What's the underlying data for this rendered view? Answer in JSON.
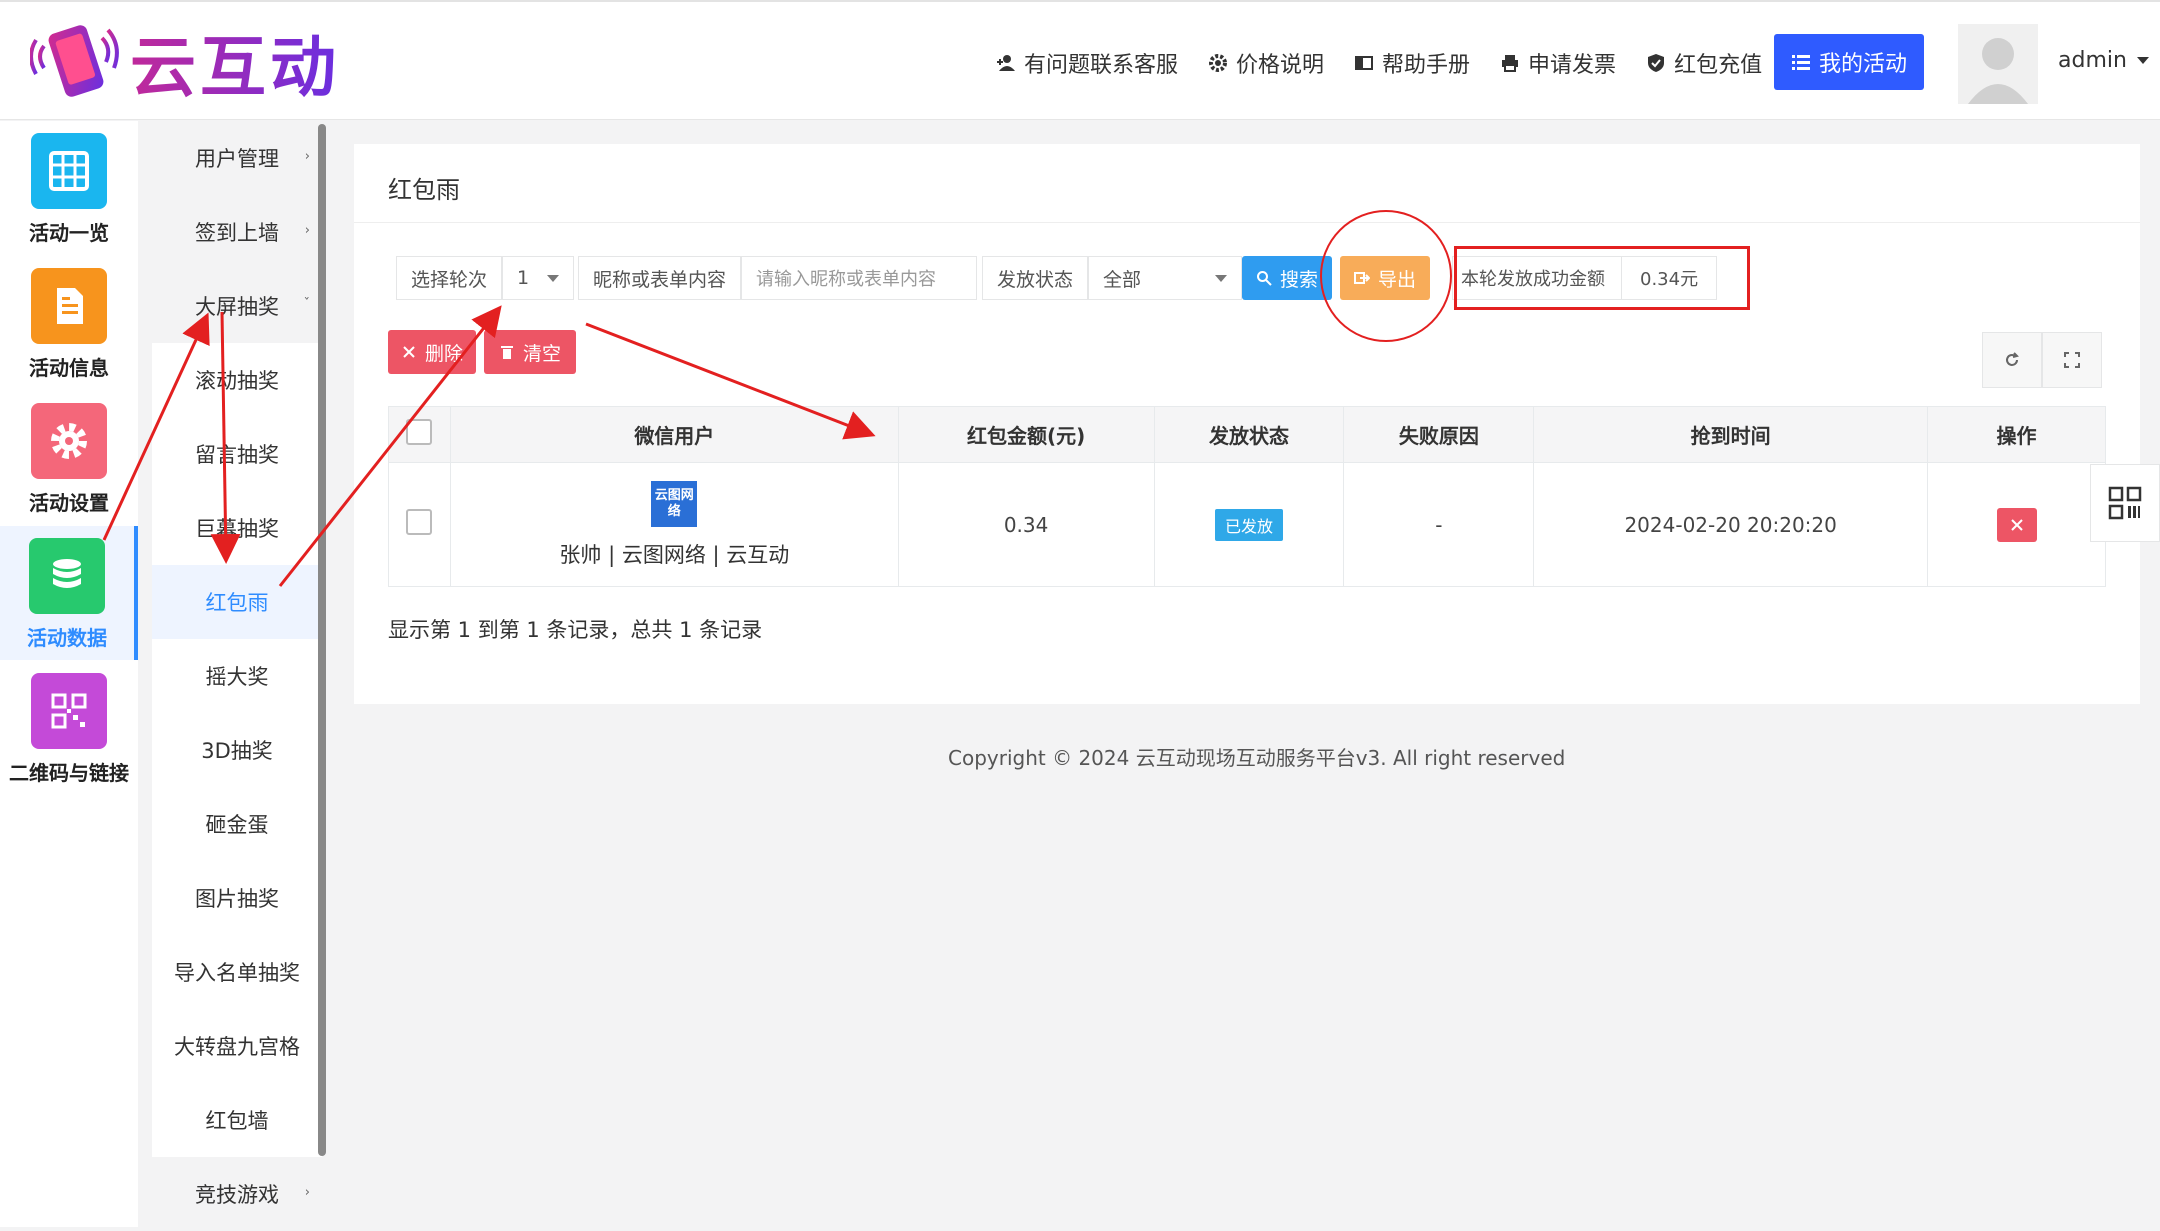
{
  "brand": {
    "name": "云互动"
  },
  "topnav": [
    {
      "label": "有问题联系客服",
      "icon": "user-plus-icon"
    },
    {
      "label": "价格说明",
      "icon": "gear-icon"
    },
    {
      "label": "帮助手册",
      "icon": "book-icon"
    },
    {
      "label": "申请发票",
      "icon": "printer-icon"
    },
    {
      "label": "红包充值",
      "icon": "shield-check-icon"
    }
  ],
  "my_activity_label": "我的活动",
  "user": {
    "name": "admin"
  },
  "rail": [
    {
      "label": "活动一览",
      "icon": "grid-icon",
      "color": "#1ab6ef"
    },
    {
      "label": "活动信息",
      "icon": "document-icon",
      "color": "#f7941d"
    },
    {
      "label": "活动设置",
      "icon": "gear-icon",
      "color": "#f4677a"
    },
    {
      "label": "活动数据",
      "icon": "database-icon",
      "color": "#27c96e"
    },
    {
      "label": "二维码与链接",
      "icon": "qrcode-icon",
      "color": "#c44ad8"
    }
  ],
  "submenu": [
    "用户管理",
    "签到上墙",
    "大屏抽奖",
    "滚动抽奖",
    "留言抽奖",
    "巨幕抽奖",
    "红包雨",
    "摇大奖",
    "3D抽奖",
    "砸金蛋",
    "图片抽奖",
    "导入名单抽奖",
    "大转盘九宫格",
    "红包墙",
    "竞技游戏"
  ],
  "panel": {
    "title": "红包雨",
    "filters": {
      "round_label": "选择轮次",
      "round_value": "1",
      "nickname_label": "昵称或表单内容",
      "nickname_placeholder": "请输入昵称或表单内容",
      "status_label": "发放状态",
      "status_value": "全部"
    },
    "search_label": "搜索",
    "export_label": "导出",
    "summary_label": "本轮发放成功金额",
    "summary_value": "0.34元",
    "delete_label": "删除",
    "clear_label": "清空",
    "table": {
      "headers": [
        "微信用户",
        "红包金额(元)",
        "发放状态",
        "失败原因",
        "抢到时间",
        "操作"
      ],
      "rows": [
        {
          "logo_text": "云图网络",
          "user": "张帅 | 云图网络 | 云互动",
          "amount": "0.34",
          "status": "已发放",
          "reason": "-",
          "time": "2024-02-20 20:20:20"
        }
      ]
    },
    "records": "显示第 1 到第 1 条记录，总共 1 条记录"
  },
  "footer": "Copyright © 2024 云互动现场互动服务平台v3. All right reserved",
  "colors": {
    "primary": "#2f5bff",
    "info": "#2f8cff",
    "danger": "#ed5565",
    "warning": "#f8ac59",
    "annotation": "#e32020"
  }
}
